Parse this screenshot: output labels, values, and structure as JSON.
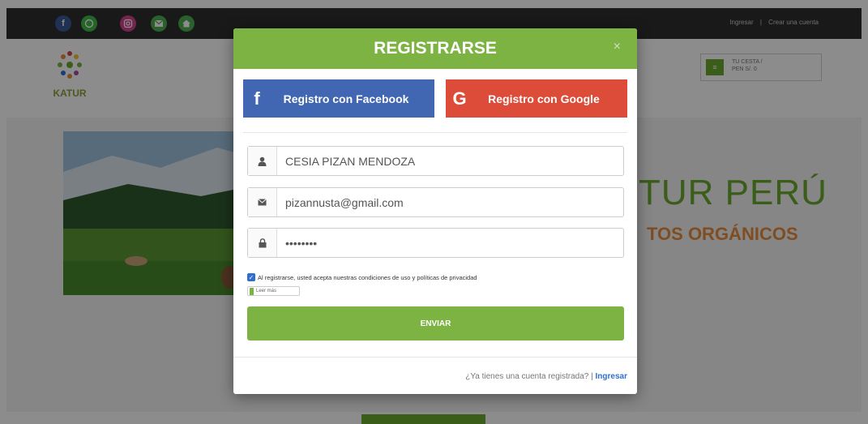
{
  "topbar": {
    "social": [
      "facebook-icon",
      "whatsapp-icon",
      "instagram-icon",
      "mail-icon",
      "home-icon"
    ],
    "login_link": "Ingresar",
    "separator": "|",
    "create_account_link": "Crear una cuenta"
  },
  "header": {
    "logo_text": "KATUR",
    "account_line1": "TU CESTA /",
    "account_line2": "PEN S/. 0"
  },
  "hero": {
    "title": "TUR PERÚ",
    "subtitle": "TOS ORGÁNICOS"
  },
  "modal": {
    "title": "REGISTRARSE",
    "close": "×",
    "facebook_label": "Registro con Facebook",
    "facebook_icon_glyph": "f",
    "google_label": "Registro con Google",
    "google_icon_glyph": "G",
    "name_value": "CESIA PIZAN MENDOZA",
    "email_value": "pizannusta@gmail.com",
    "password_value": "••••••••",
    "terms_text": "Al registrarse, usted acepta nuestras condiciones de uso y políticas de privacidad",
    "read_more": "Leer más",
    "submit_label": "ENVIAR",
    "footer_question": "¿Ya tienes una cuenta registrada? |",
    "footer_link": "Ingresar"
  },
  "colors": {
    "brand_green": "#7cb342",
    "facebook": "#4267b2",
    "google": "#dd4b39",
    "link_blue": "#2f6fd0"
  }
}
